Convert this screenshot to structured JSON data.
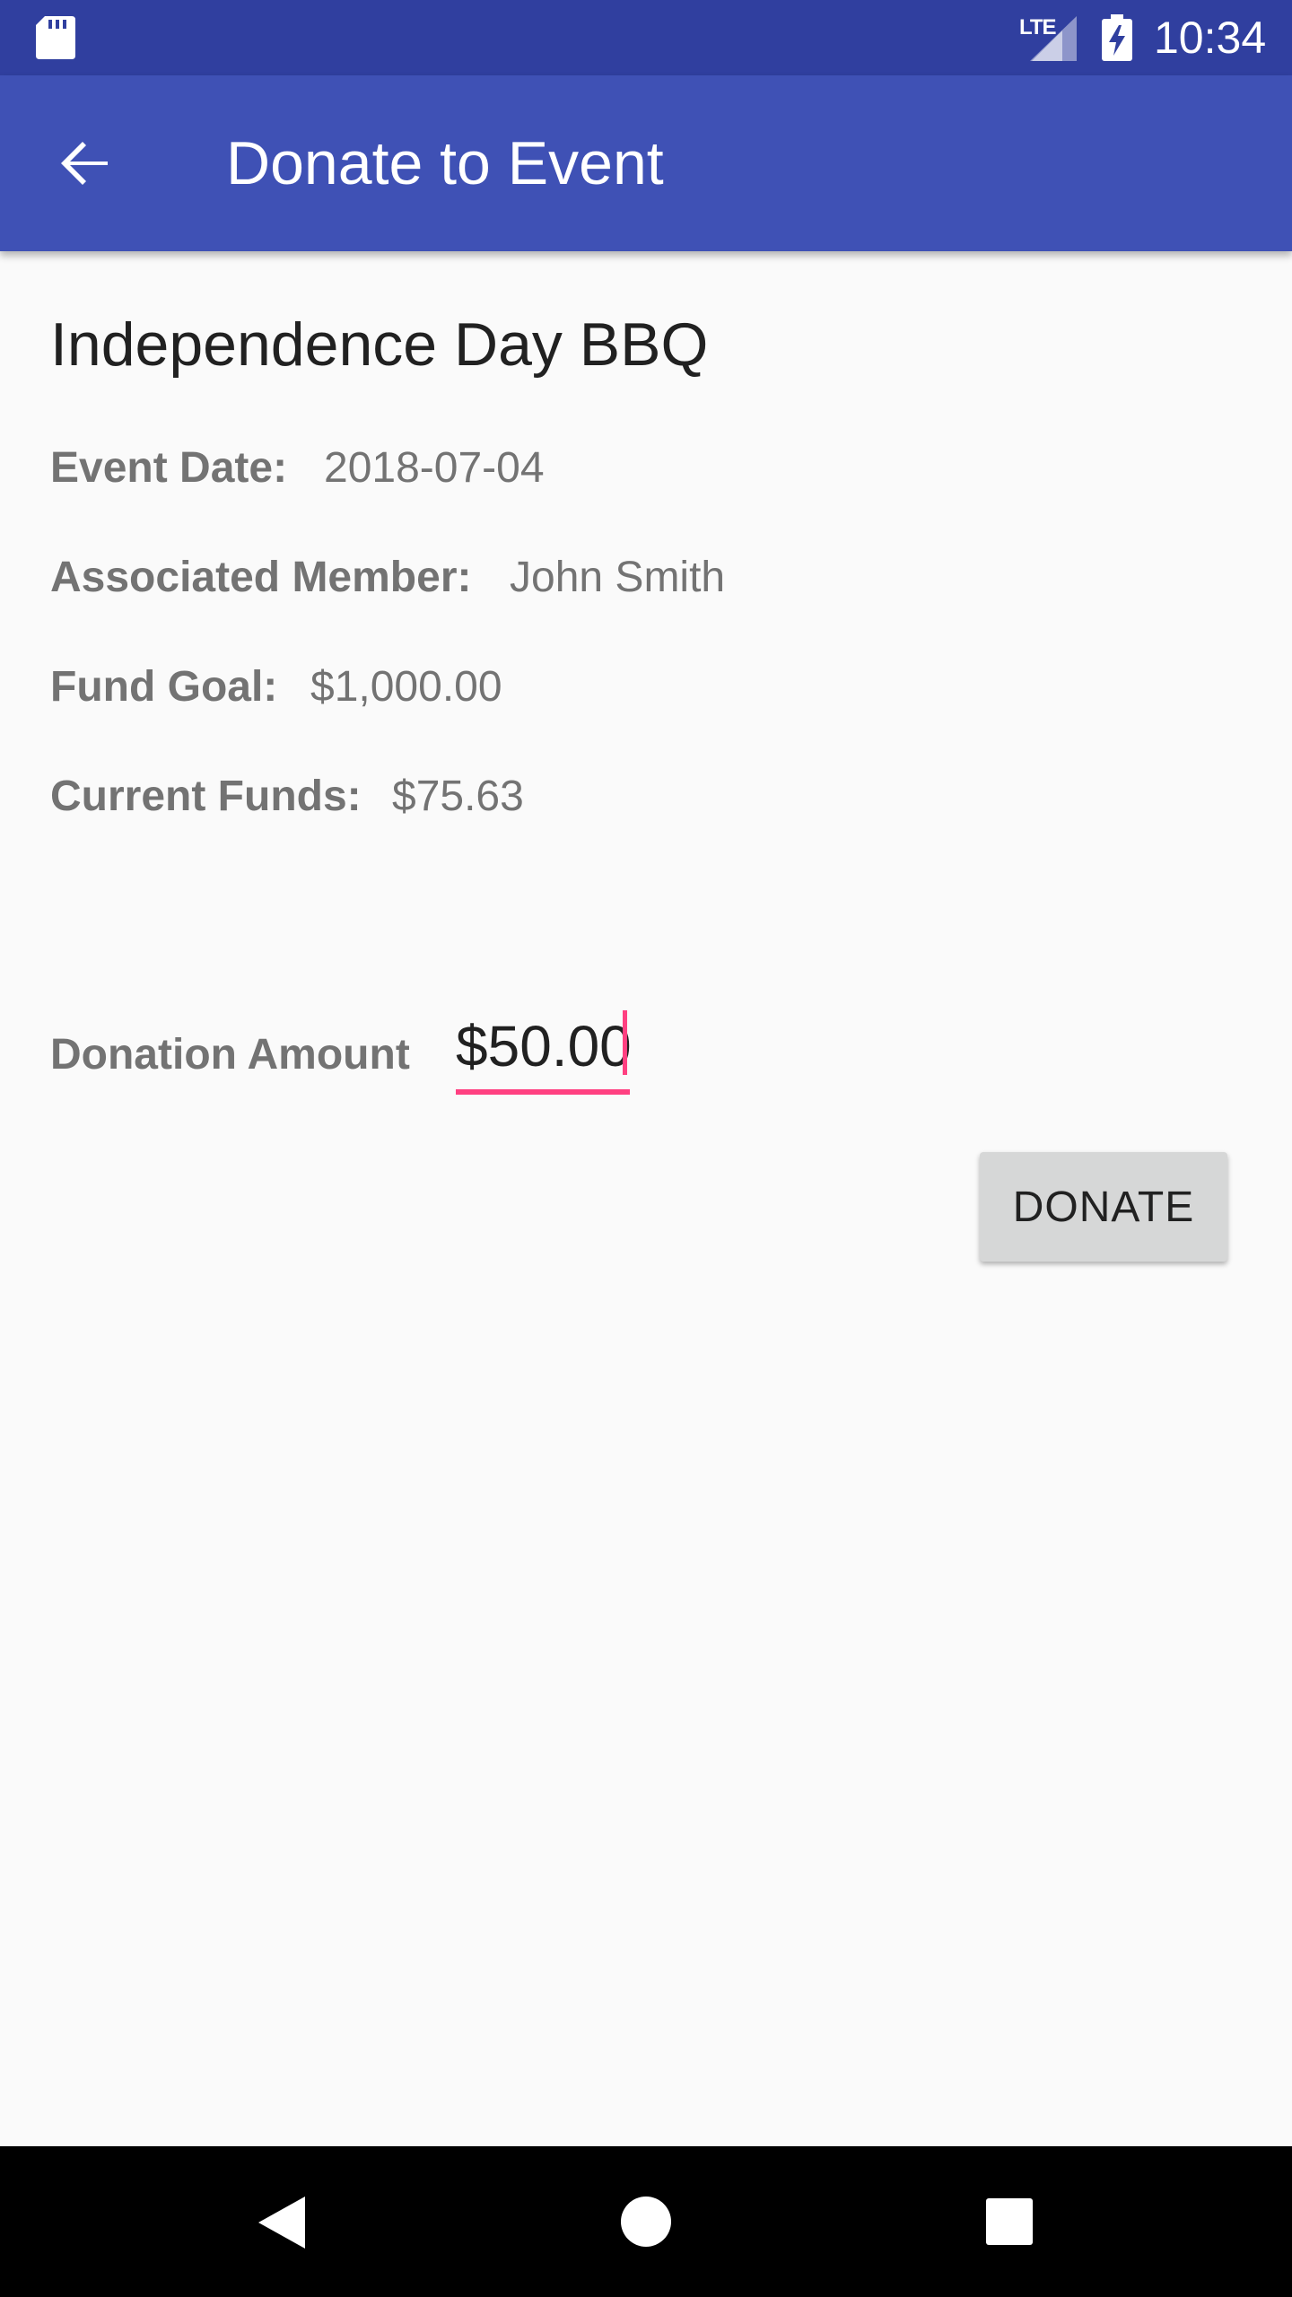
{
  "status_bar": {
    "network_label": "LTE",
    "time": "10:34",
    "icons": [
      "sd-card-icon",
      "signal-icon",
      "battery-charging-icon"
    ]
  },
  "app_bar": {
    "title": "Donate to Event",
    "back_icon": "arrow-back-icon"
  },
  "event": {
    "name": "Independence Day BBQ",
    "fields": [
      {
        "label": "Event Date:",
        "value": "2018-07-04"
      },
      {
        "label": "Associated Member:",
        "value": "John Smith"
      },
      {
        "label": "Fund Goal:",
        "value": "$1,000.00"
      },
      {
        "label": "Current Funds:",
        "value": "$75.63"
      }
    ]
  },
  "donation": {
    "label": "Donation Amount",
    "value": "$50.00",
    "button_label": "DONATE"
  },
  "navigation": {
    "icons": [
      "nav-back-icon",
      "nav-home-icon",
      "nav-recents-icon"
    ]
  },
  "colors": {
    "status_bar": "#303f9f",
    "app_bar": "#3f51b5",
    "accent": "#ff4081",
    "background": "#fafafa",
    "label_text": "#737373",
    "primary_text": "#212121"
  }
}
